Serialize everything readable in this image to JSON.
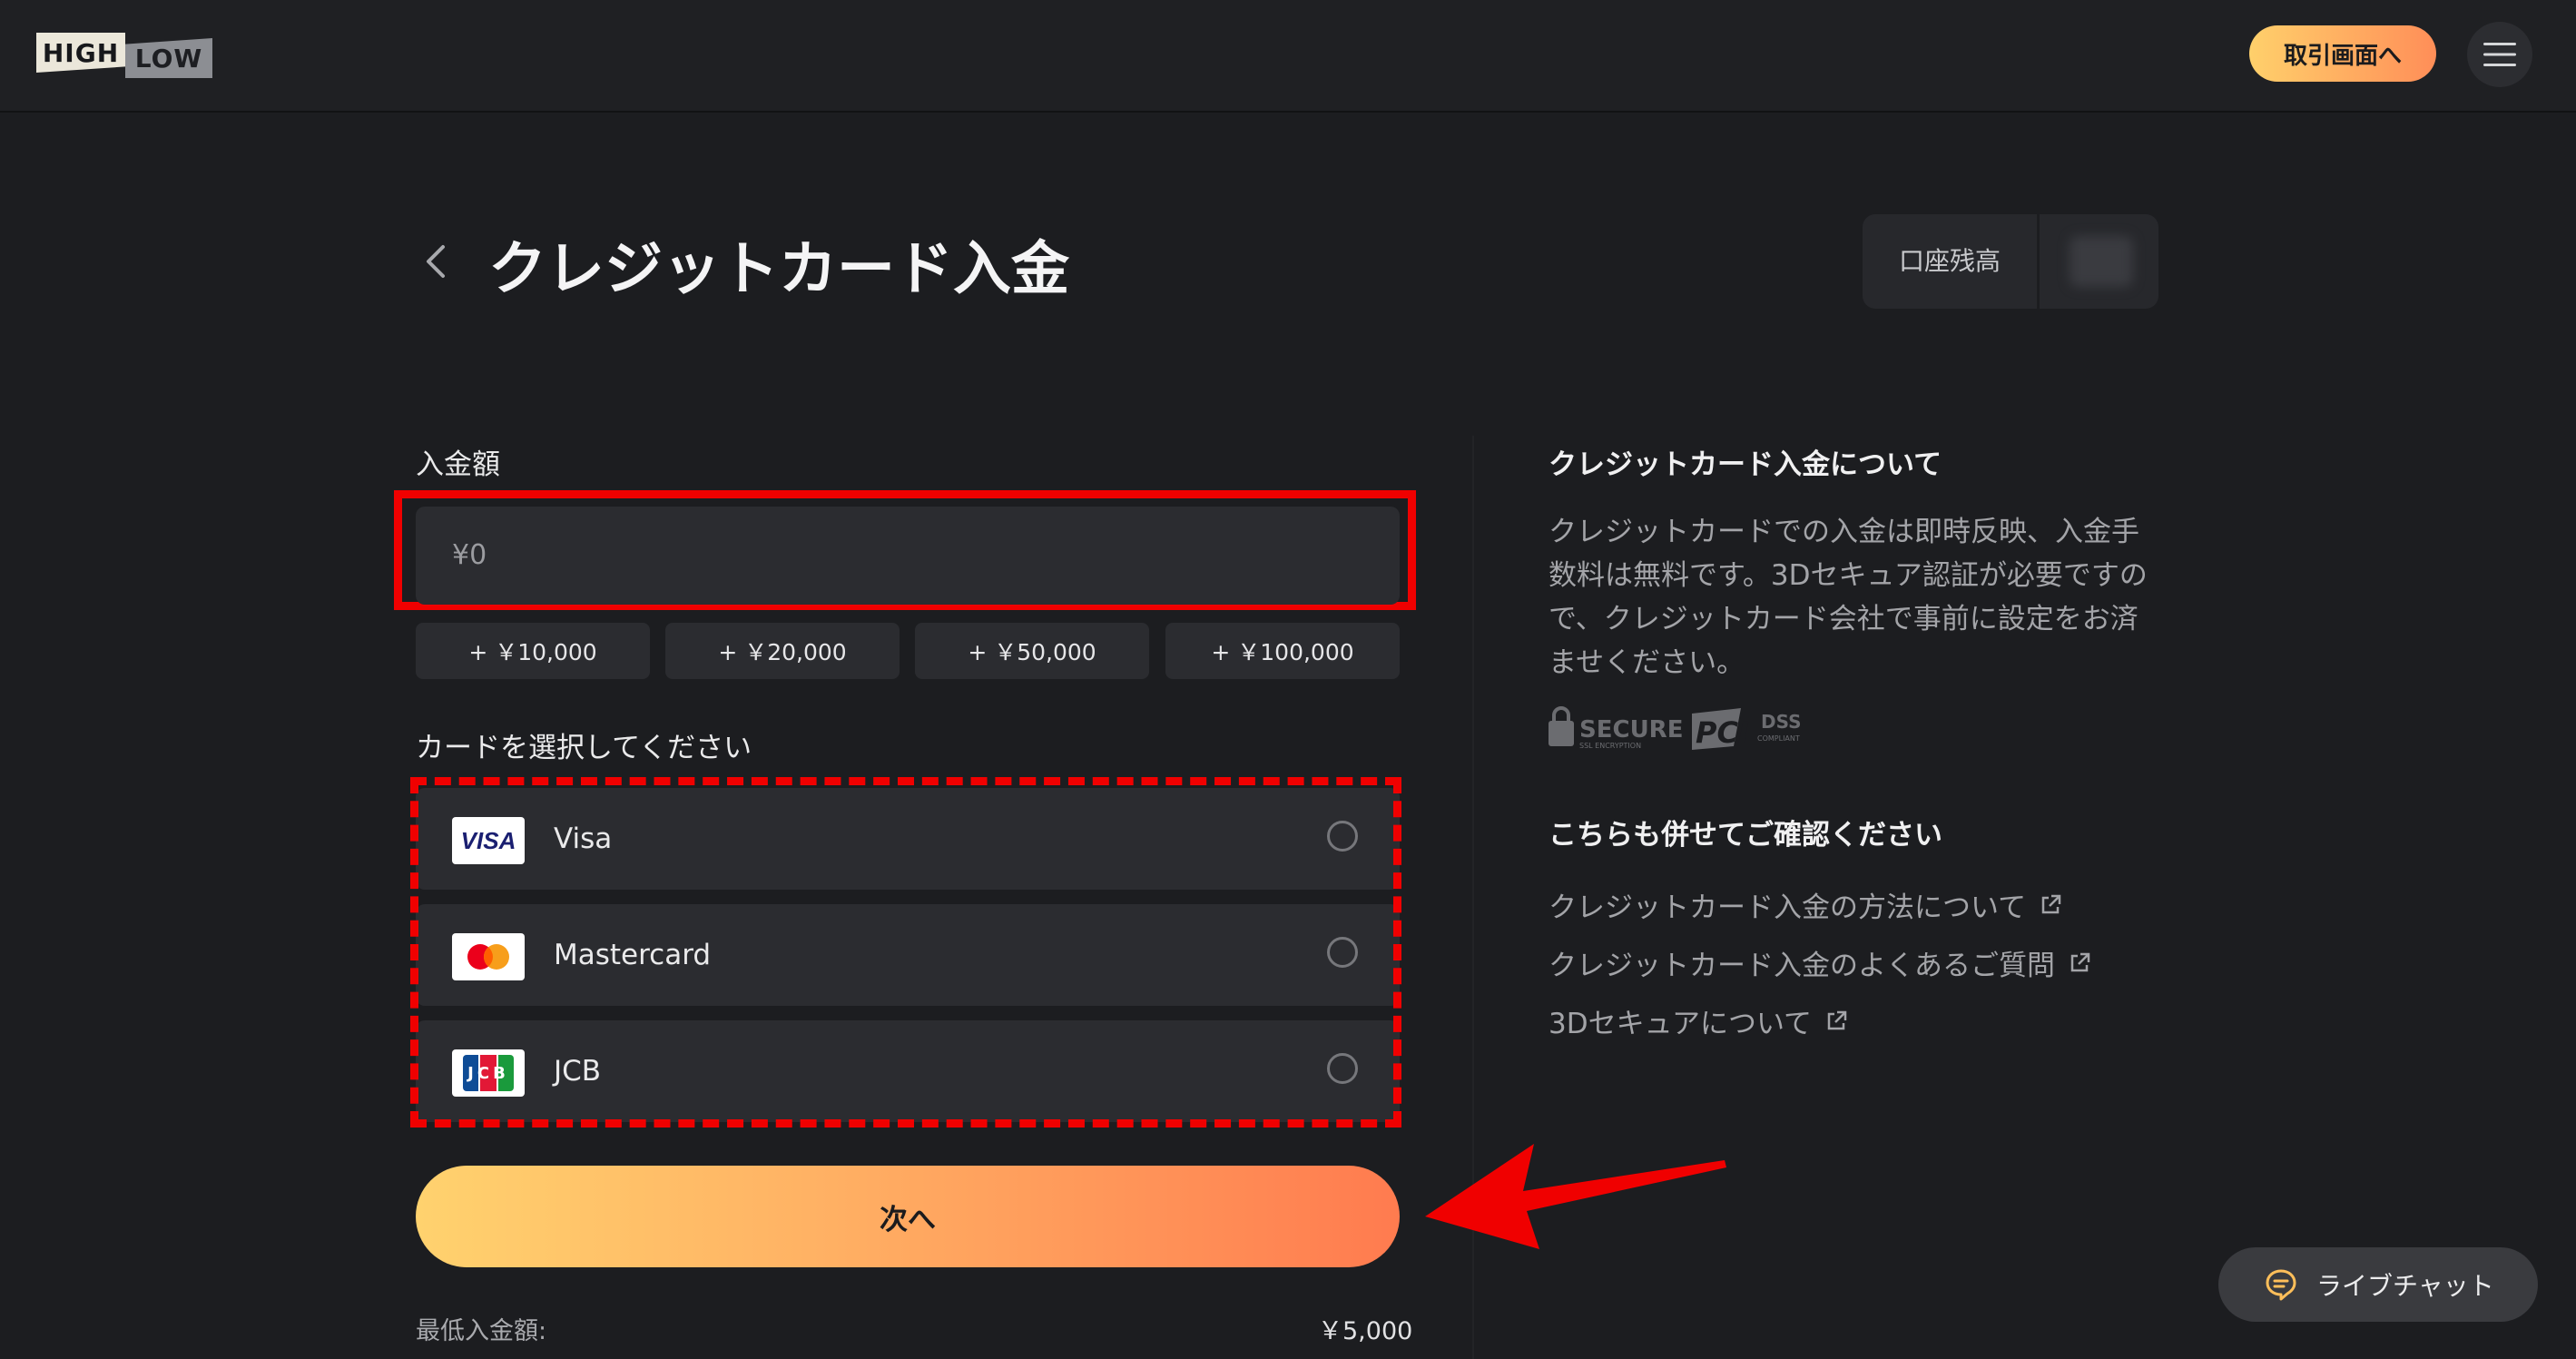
{
  "header": {
    "logo_high": "HIGH",
    "logo_low": "LOW",
    "trade_button": "取引画面へ",
    "menu_icon": "hamburger-menu-icon"
  },
  "page": {
    "title": "クレジットカード入金",
    "back_icon": "chevron-left-icon",
    "balance_label": "口座残高"
  },
  "deposit": {
    "amount_label": "入金額",
    "amount_placeholder": "¥0",
    "quick_amounts": [
      "+ ￥10,000",
      "+ ￥20,000",
      "+ ￥50,000",
      "+ ￥100,000"
    ],
    "card_label": "カードを選択してください",
    "cards": [
      {
        "name": "Visa",
        "logo": "VISA"
      },
      {
        "name": "Mastercard",
        "logo": "mastercard-logo"
      },
      {
        "name": "JCB",
        "logo": "JCB"
      }
    ],
    "next_button": "次へ",
    "min_label": "最低入金額:",
    "min_value": "￥5,000"
  },
  "info": {
    "title": "クレジットカード入金について",
    "body": "クレジットカードでの入金は即時反映、入金手数料は無料です。3Dセキュア認証が必要ですので、クレジットカード会社で事前に設定をお済ませください。",
    "badge_secure": "SECURE",
    "badge_secure_sub": "SSL ENCRYPTION",
    "badge_pci": "PCI",
    "badge_dss": "DSS",
    "badge_compliant": "COMPLIANT",
    "more_title": "こちらも併せてご確認ください",
    "links": [
      "クレジットカード入金の方法について",
      "クレジットカード入金のよくあるご質問",
      "3Dセキュアについて"
    ]
  },
  "chat": {
    "label": "ライブチャット"
  },
  "colors": {
    "background": "#1c1d20",
    "panel": "#2b2c30",
    "accent_start": "#ffd26e",
    "accent_end": "#ff7b4f",
    "annotation": "#f00000"
  }
}
